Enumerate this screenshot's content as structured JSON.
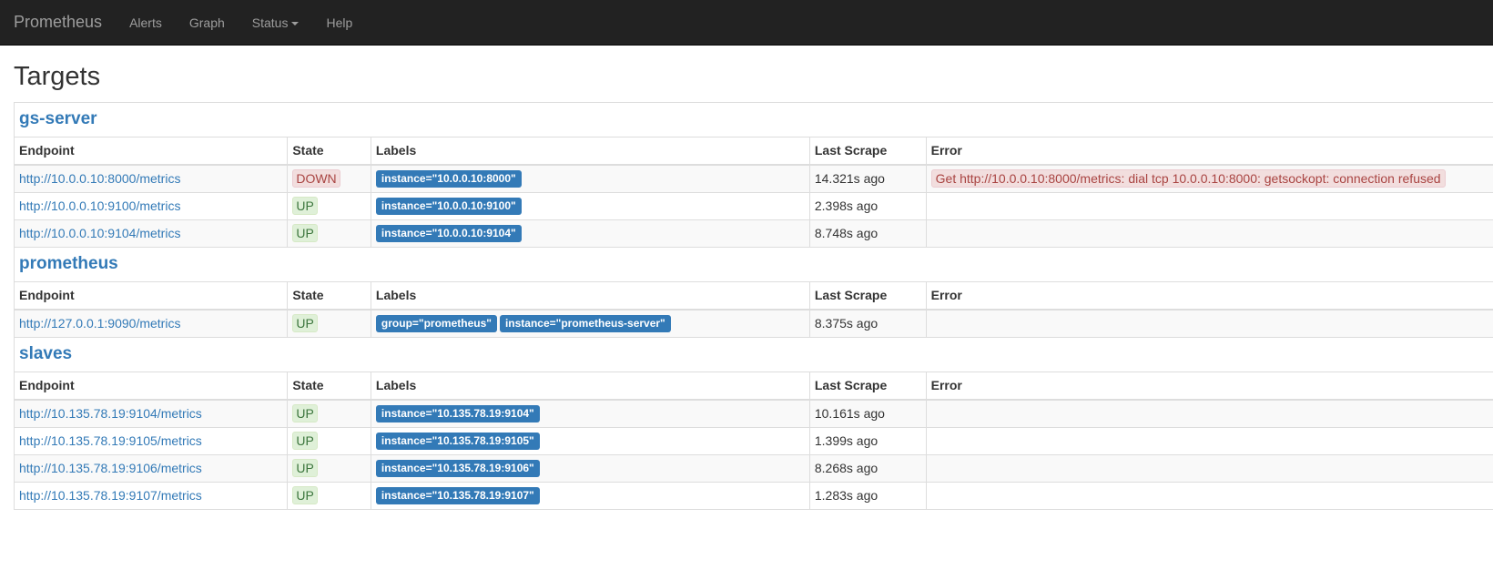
{
  "nav": {
    "brand": "Prometheus",
    "items": [
      "Alerts",
      "Graph",
      "Status",
      "Help"
    ]
  },
  "page_title": "Targets",
  "columns": [
    "Endpoint",
    "State",
    "Labels",
    "Last Scrape",
    "Error"
  ],
  "groups": [
    {
      "name": "gs-server",
      "rows": [
        {
          "endpoint": "http://10.0.0.10:8000/metrics",
          "state": "DOWN",
          "labels": [
            "instance=\"10.0.0.10:8000\""
          ],
          "last_scrape": "14.321s ago",
          "error": "Get http://10.0.0.10:8000/metrics: dial tcp 10.0.0.10:8000: getsockopt: connection refused"
        },
        {
          "endpoint": "http://10.0.0.10:9100/metrics",
          "state": "UP",
          "labels": [
            "instance=\"10.0.0.10:9100\""
          ],
          "last_scrape": "2.398s ago",
          "error": ""
        },
        {
          "endpoint": "http://10.0.0.10:9104/metrics",
          "state": "UP",
          "labels": [
            "instance=\"10.0.0.10:9104\""
          ],
          "last_scrape": "8.748s ago",
          "error": ""
        }
      ]
    },
    {
      "name": "prometheus",
      "rows": [
        {
          "endpoint": "http://127.0.0.1:9090/metrics",
          "state": "UP",
          "labels": [
            "group=\"prometheus\"",
            "instance=\"prometheus-server\""
          ],
          "last_scrape": "8.375s ago",
          "error": ""
        }
      ]
    },
    {
      "name": "slaves",
      "rows": [
        {
          "endpoint": "http://10.135.78.19:9104/metrics",
          "state": "UP",
          "labels": [
            "instance=\"10.135.78.19:9104\""
          ],
          "last_scrape": "10.161s ago",
          "error": ""
        },
        {
          "endpoint": "http://10.135.78.19:9105/metrics",
          "state": "UP",
          "labels": [
            "instance=\"10.135.78.19:9105\""
          ],
          "last_scrape": "1.399s ago",
          "error": ""
        },
        {
          "endpoint": "http://10.135.78.19:9106/metrics",
          "state": "UP",
          "labels": [
            "instance=\"10.135.78.19:9106\""
          ],
          "last_scrape": "8.268s ago",
          "error": ""
        },
        {
          "endpoint": "http://10.135.78.19:9107/metrics",
          "state": "UP",
          "labels": [
            "instance=\"10.135.78.19:9107\""
          ],
          "last_scrape": "1.283s ago",
          "error": ""
        }
      ]
    }
  ]
}
